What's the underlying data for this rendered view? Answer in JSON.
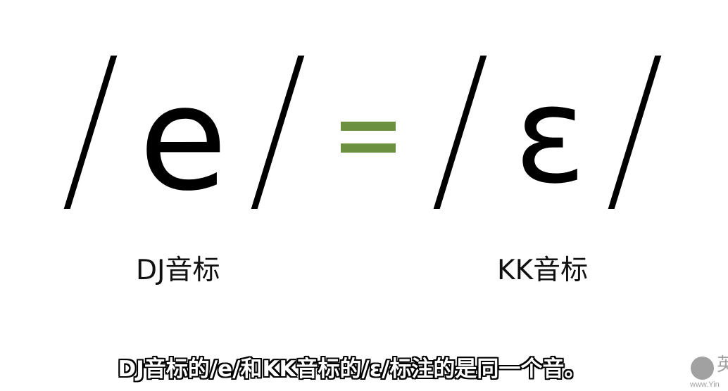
{
  "slide": {
    "left_phoneme": "e",
    "right_phoneme": "ɛ",
    "left_system_label": "DJ音标",
    "right_system_label": "KK音标",
    "equals_color": "#6b9140"
  },
  "subtitle": {
    "text": "DJ音标的/e/和KK音标的/ɛ/标注的是同一个音。"
  },
  "watermark": {
    "glyph": "英",
    "url": "www.Yin"
  }
}
